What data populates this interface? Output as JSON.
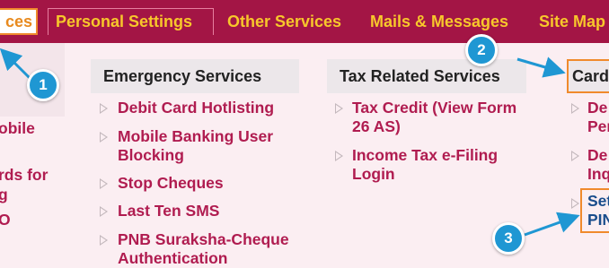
{
  "nav": {
    "tabs": [
      {
        "label": "ces"
      },
      {
        "label": "Personal Settings"
      },
      {
        "label": "Other Services"
      },
      {
        "label": "Mails & Messages"
      },
      {
        "label": "Site Map"
      }
    ]
  },
  "left_column_fragments": [
    "obile",
    "rds for",
    "g",
    "O"
  ],
  "columns": {
    "emergency": {
      "heading": "Emergency Services",
      "links": [
        "Debit Card Hotlisting",
        "Mobile Banking User Blocking",
        "Stop Cheques",
        "Last Ten SMS",
        "PNB Suraksha-Cheque Authentication"
      ]
    },
    "tax": {
      "heading": "Tax Related Services",
      "links": [
        "Tax Credit (View Form 26 AS)",
        "Income Tax e-Filing Login"
      ]
    },
    "card": {
      "heading": "Card",
      "links": [
        "De Per",
        "De Inq",
        "Set PIN"
      ]
    }
  },
  "callouts": [
    "1",
    "2",
    "3"
  ],
  "colors": {
    "topbar": "#a31545",
    "tab_text": "#f7c72b",
    "link": "#b01c50",
    "highlight_box": "#f08a2c",
    "callout": "#1f97d3"
  }
}
